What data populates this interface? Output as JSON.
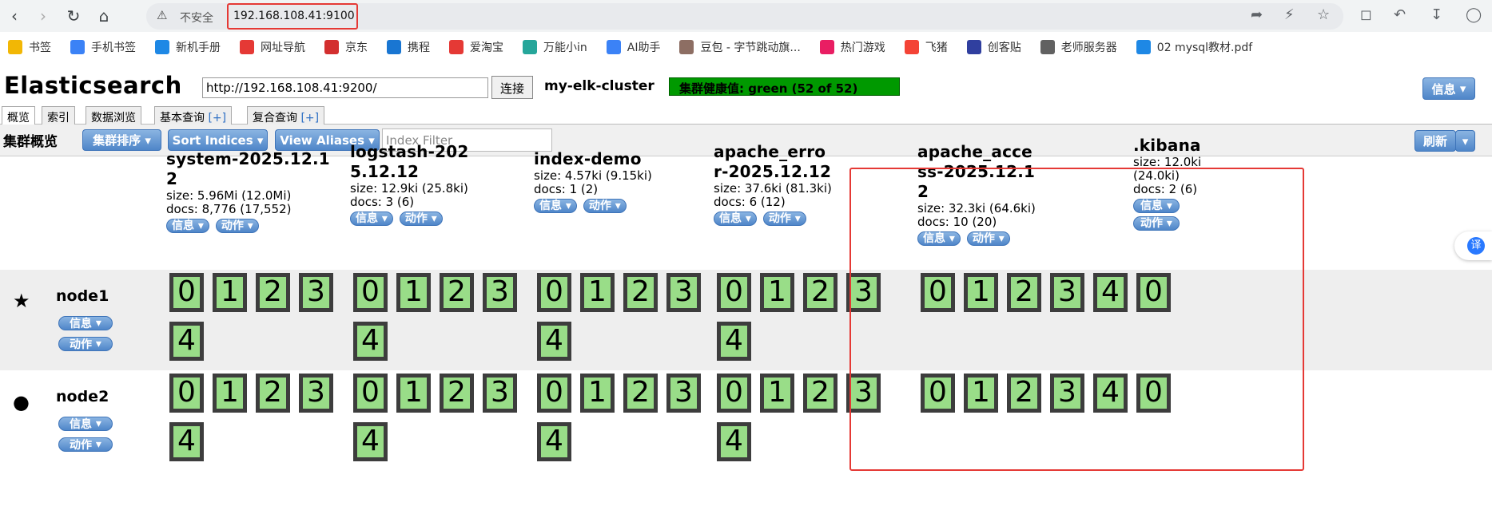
{
  "browser": {
    "insecure_label": "不安全",
    "url": "192.168.108.41:9100"
  },
  "bookmarks": [
    "书签",
    "手机书签",
    "新机手册",
    "网址导航",
    "京东",
    "携程",
    "爱淘宝",
    "万能小in",
    "AI助手",
    "豆包 - 字节跳动旗...",
    "热门游戏",
    "飞猪",
    "创客贴",
    "老师服务器",
    "02 mysql教材.pdf"
  ],
  "app": {
    "title": "Elasticsearch",
    "connect_url": "http://192.168.108.41:9200/",
    "connect_label": "连接",
    "cluster_name": "my-elk-cluster",
    "health": "集群健康值: green (52 of 52)",
    "info_label": "信息"
  },
  "tabs": [
    "概览",
    "索引",
    "数据浏览",
    "基本查询",
    "复合查询"
  ],
  "tab_plus": "[+]",
  "toolbar": {
    "title": "集群概览",
    "sort_cluster": "集群排序",
    "sort_indices": "Sort Indices",
    "view_aliases": "View Aliases",
    "filter_placeholder": "Index Filter",
    "refresh": "刷新"
  },
  "index_actions": {
    "info": "信息",
    "action": "动作"
  },
  "indices": [
    {
      "name": "system-2025.12.12",
      "size": "size: 5.96Mi (12.0Mi)",
      "docs": "docs: 8,776 (17,552)"
    },
    {
      "name": "logstash-2025.12.12",
      "size": "size: 12.9ki (25.8ki)",
      "docs": "docs: 3 (6)"
    },
    {
      "name": "index-demo",
      "size": "size: 4.57ki (9.15ki)",
      "docs": "docs: 1 (2)"
    },
    {
      "name": "apache_error-2025.12.12",
      "size": "size: 37.6ki (81.3ki)",
      "docs": "docs: 6 (12)"
    },
    {
      "name": "apache_access-2025.12.12",
      "size": "size: 32.3ki (64.6ki)",
      "docs": "docs: 10 (20)"
    },
    {
      "name": ".kibana",
      "size": "size: 12.0ki (24.0ki)",
      "docs": "docs: 2 (6)"
    }
  ],
  "nodes": [
    {
      "name": "node1",
      "master": true
    },
    {
      "name": "node2",
      "master": false
    }
  ],
  "shard_numbers": [
    "0",
    "1",
    "2",
    "3",
    "4"
  ],
  "colors": {
    "shard": "#99dd88",
    "health": "#009900",
    "highlight": "#e53935"
  }
}
